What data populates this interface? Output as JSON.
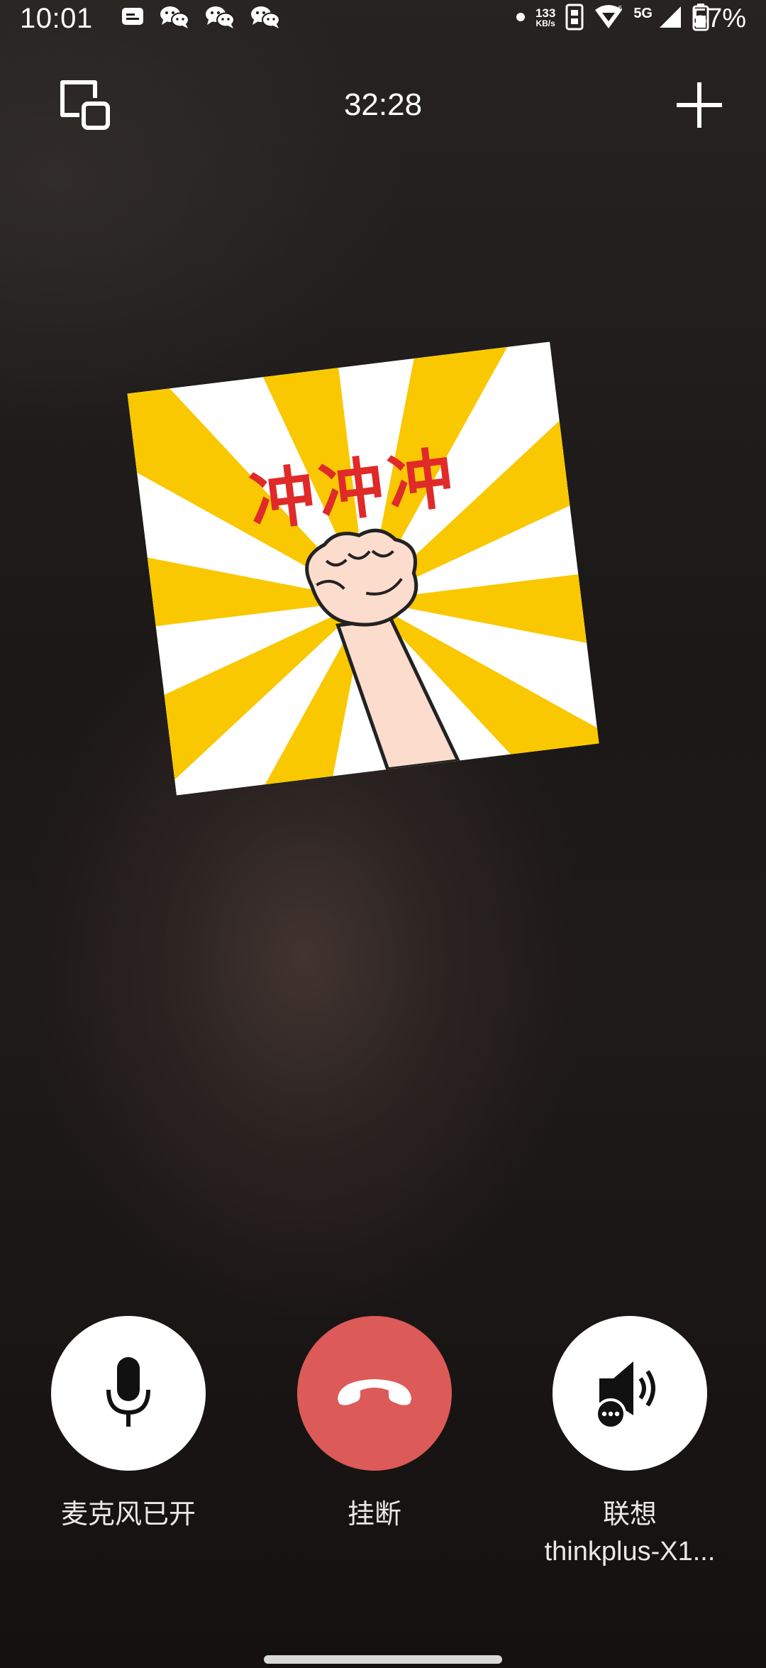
{
  "status_bar": {
    "time": "10:01",
    "net_speed_value": "133",
    "net_speed_unit": "KB/s",
    "signal_type": "5G",
    "battery_percent": "57%",
    "notification_icons": [
      "message-icon",
      "wechat-icon",
      "wechat-icon",
      "wechat-icon"
    ]
  },
  "call": {
    "timer": "32:28",
    "avatar_sticker_text": "冲冲冲"
  },
  "controls": {
    "mic_label": "麦克风已开",
    "hangup_label": "挂断",
    "speaker_label_line1": "联想",
    "speaker_label_line2": "thinkplus-X1..."
  },
  "colors": {
    "hangup_red": "#dc5a58",
    "sticker_yellow": "#f9c800",
    "sticker_text_red": "#e02a2a"
  }
}
